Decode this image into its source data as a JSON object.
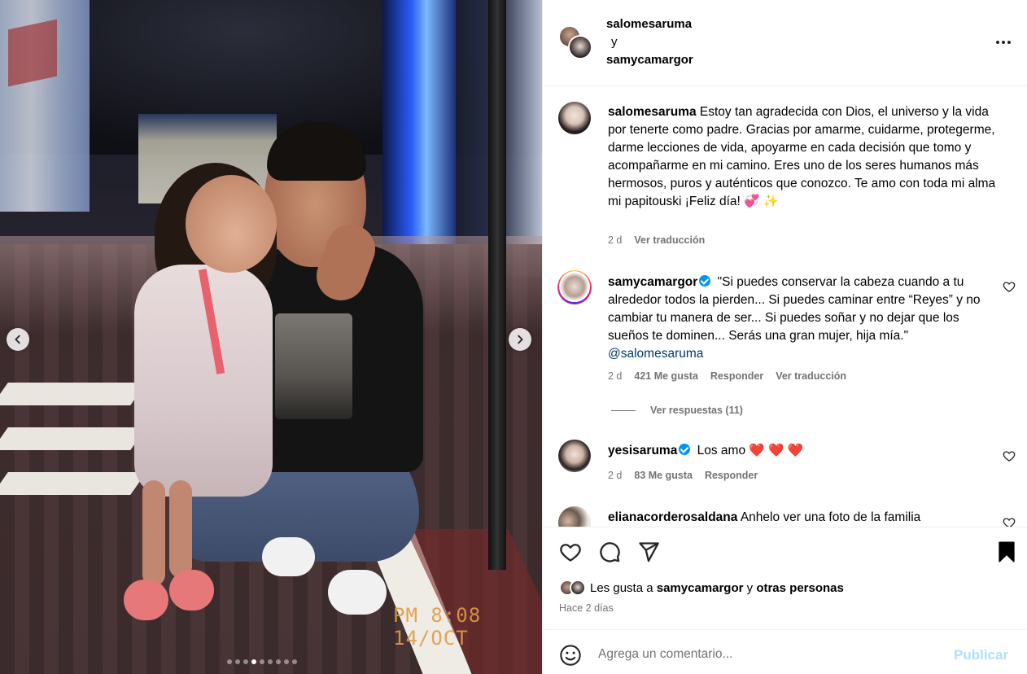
{
  "post": {
    "photo_timestamp": "PM 8:08 14/OCT",
    "carousel": {
      "total": 9,
      "active_index": 3
    }
  },
  "header": {
    "user1": "salomesaruma",
    "connector": "y",
    "user2": "samycamargor"
  },
  "comments": [
    {
      "user": "salomesaruma",
      "verified": false,
      "text": "Estoy tan agradecida con Dios, el universo y la vida por tenerte como padre. Gracias por amarme, cuidarme, protegerme, darme lecciones de vida, apoyarme en cada decisión que tomo y acompañarme en mi camino. Eres uno de los seres humanos más hermosos, puros y auténticos que conozco. Te amo con toda mi alma mi papitouski ¡Feliz día! 💞 ✨",
      "time": "2 d",
      "translate": "Ver traducción"
    },
    {
      "user": "samycamargor",
      "verified": true,
      "text": "\"Si puedes conservar la cabeza cuando a tu alrededor todos la pierden... Si puedes caminar entre “Reyes” y no cambiar tu manera de ser... Si puedes soñar y no dejar que los sueños te dominen... Serás una gran mujer, hija mía.\"",
      "mention": "@salomesaruma",
      "time": "2 d",
      "likes": "421 Me gusta",
      "reply": "Responder",
      "translate": "Ver traducción",
      "view_replies": "Ver respuestas (11)"
    },
    {
      "user": "yesisaruma",
      "verified": true,
      "text": "Los amo",
      "emoji": "❤️ ❤️ ❤️",
      "time": "2 d",
      "likes": "83 Me gusta",
      "reply": "Responder"
    },
    {
      "user": "elianacorderosaldana",
      "verified": false,
      "text": "Anhelo ver una foto de la familia"
    }
  ],
  "likes_line": {
    "prefix": "Les gusta a",
    "user": "samycamargor",
    "connector": "y",
    "others": "otras personas"
  },
  "posted_ago": "Hace 2 días",
  "composer": {
    "placeholder": "Agrega un comentario...",
    "publish": "Publicar"
  },
  "icons": {
    "like": "heart-icon",
    "comment": "comment-bubble-icon",
    "share": "paper-plane-icon",
    "save": "bookmark-filled-icon",
    "more": "ellipsis-icon",
    "emoji": "smiley-icon"
  },
  "colors": {
    "verified": "#0095f6",
    "muted": "#737373",
    "publish_disabled": "#b2dffc",
    "mention": "#00376b"
  }
}
